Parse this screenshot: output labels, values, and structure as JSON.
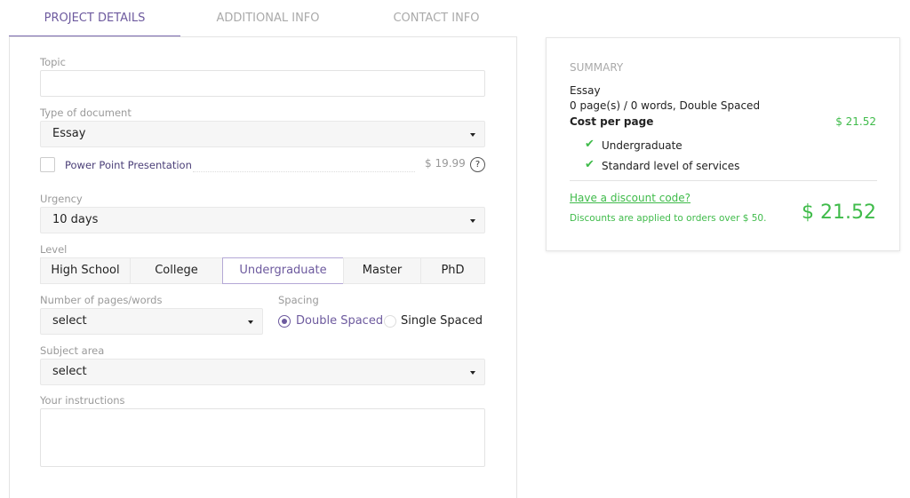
{
  "tabs": [
    {
      "label": "PROJECT DETAILS",
      "active": true
    },
    {
      "label": "ADDITIONAL INFO"
    },
    {
      "label": "CONTACT INFO"
    }
  ],
  "form": {
    "topic": {
      "label": "Topic",
      "value": ""
    },
    "doc_type": {
      "label": "Type of document",
      "value": "Essay"
    },
    "ppt": {
      "label": "Power Point Presentation",
      "price": "$ 19.99",
      "checked": false,
      "help_icon": "question-circle-icon"
    },
    "urgency": {
      "label": "Urgency",
      "value": "10 days"
    },
    "level": {
      "label": "Level",
      "options": [
        "High School",
        "College",
        "Undergraduate",
        "Master",
        "PhD"
      ],
      "selected": "Undergraduate"
    },
    "pages": {
      "label": "Number of pages/words",
      "value": "select"
    },
    "spacing": {
      "label": "Spacing",
      "options": [
        "Double Spaced",
        "Single Spaced"
      ],
      "selected": "Double Spaced"
    },
    "subject": {
      "label": "Subject area",
      "value": "select"
    },
    "instructions": {
      "label": "Your instructions",
      "value": ""
    }
  },
  "summary": {
    "title": "SUMMARY",
    "doc": "Essay",
    "details": "0 page(s) / 0 words, Double Spaced",
    "cost_label": "Cost per page",
    "cost_value": "$ 21.52",
    "features": [
      "Undergraduate",
      "Standard level of services"
    ],
    "discount_link": "Have a discount code?",
    "discount_note": "Discounts are applied to orders over $ 50.",
    "total": "$ 21.52"
  },
  "colors": {
    "accent": "#6d5a9e",
    "green": "#3fbb4a"
  }
}
